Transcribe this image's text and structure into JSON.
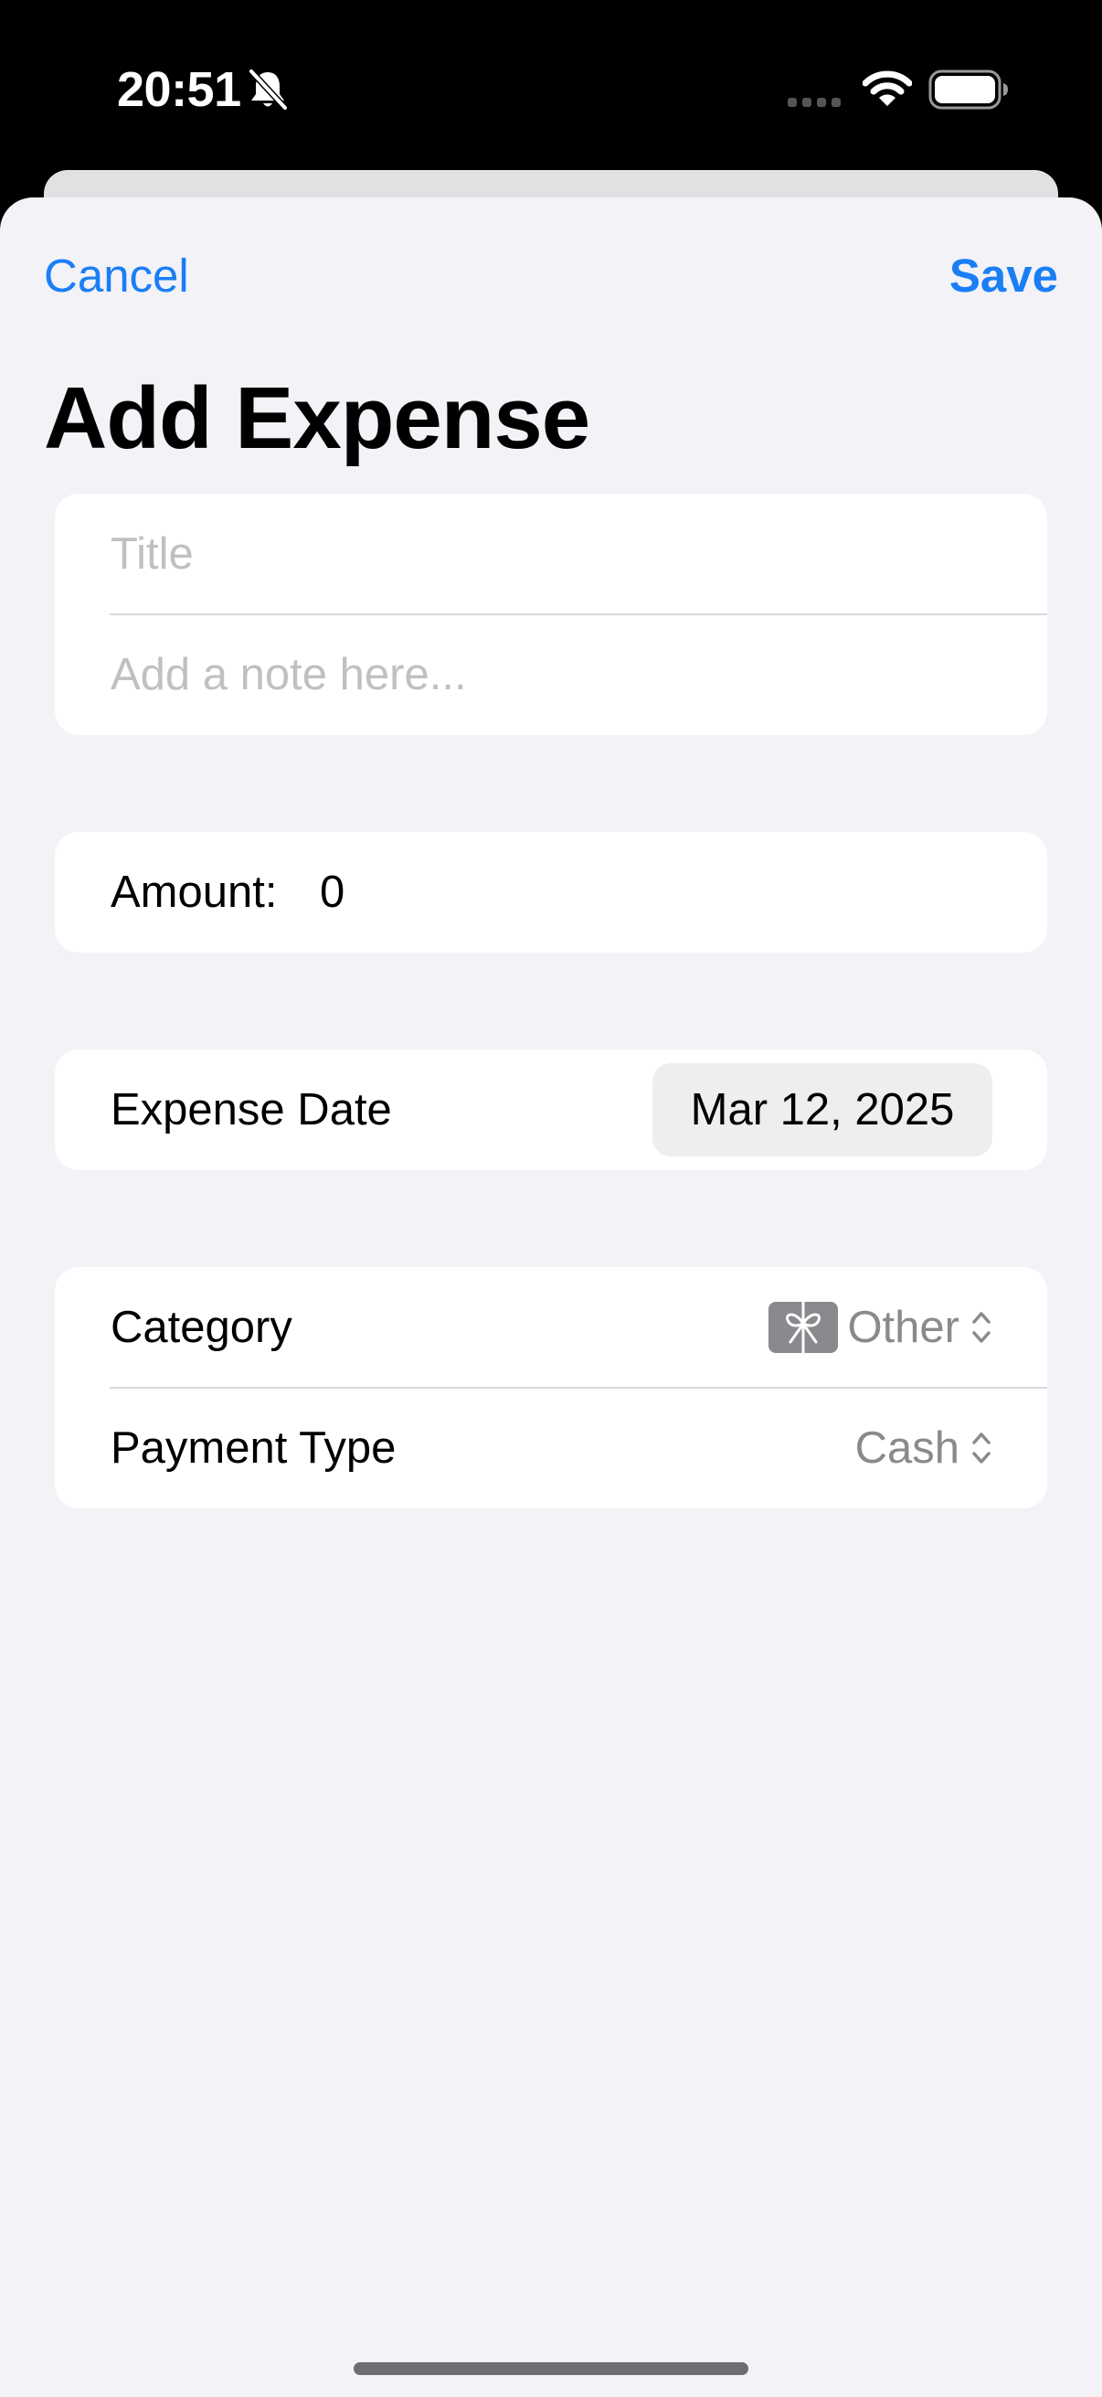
{
  "status_bar": {
    "time": "20:51",
    "bell_icon": "bell-slash-icon",
    "signal_icon": "signal-dots-icon",
    "wifi_icon": "wifi-icon",
    "battery_icon": "battery-icon"
  },
  "nav": {
    "cancel_label": "Cancel",
    "save_label": "Save",
    "accent_color": "#1a7ef5"
  },
  "page_title": "Add Expense",
  "form": {
    "title_placeholder": "Title",
    "note_placeholder": "Add a note here...",
    "amount_label": "Amount:",
    "amount_value": "0",
    "date_label": "Expense Date",
    "date_value": "Mar 12, 2025",
    "category_label": "Category",
    "category_icon": "gift-icon",
    "category_value": "Other",
    "payment_label": "Payment Type",
    "payment_value": "Cash"
  }
}
